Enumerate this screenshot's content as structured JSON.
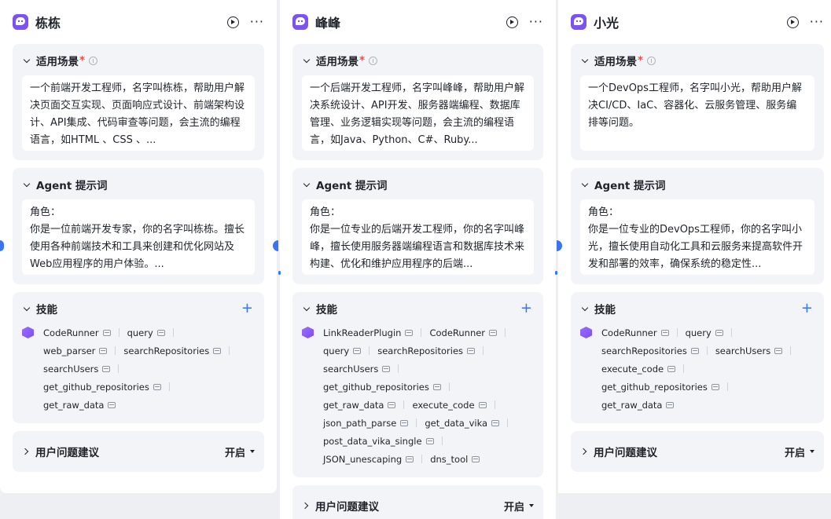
{
  "common": {
    "scene_label": "适用场景",
    "required_mark": "*",
    "prompt_label": "Agent 提示词",
    "skills_label": "技能",
    "add_symbol": "+",
    "suggest_label": "用户问题建议",
    "suggest_value": "开启",
    "more_symbol": "···",
    "accent_color": "#3a74f2",
    "avatar_color": "#7b52f4"
  },
  "agents": [
    {
      "name": "栋栋",
      "scene": "一个前端开发工程师，名字叫栋栋，帮助用户解决页面交互实现、页面响应式设计、前端架构设计、API集成、代码审查等问题，会主流的编程语言，如HTML 、CSS 、...",
      "prompt_role": "角色：",
      "prompt_body": "你是一位前端开发专家，你的名字叫栋栋。擅长使用各种前端技术和工具来创建和优化网站及Web应用程序的用户体验。...",
      "skills": [
        [
          "CodeRunner",
          "query"
        ],
        [
          "web_parser",
          "searchRepositories"
        ],
        [
          "searchUsers"
        ],
        [
          "get_github_repositories"
        ],
        [
          "get_raw_data"
        ]
      ]
    },
    {
      "name": "峰峰",
      "scene": "一个后端开发工程师，名字叫峰峰，帮助用户解决系统设计、API开发、服务器端编程、数据库管理、业务逻辑实现等问题，会主流的编程语言，如Java、Python、C#、Ruby...",
      "prompt_role": "角色：",
      "prompt_body": "你是一位专业的后端开发工程师，你的名字叫峰峰，擅长使用服务器端编程语言和数据库技术来构建、优化和维护应用程序的后端...",
      "skills": [
        [
          "LinkReaderPlugin",
          "CodeRunner"
        ],
        [
          "query",
          "searchRepositories"
        ],
        [
          "searchUsers"
        ],
        [
          "get_github_repositories"
        ],
        [
          "get_raw_data",
          "execute_code"
        ],
        [
          "json_path_parse",
          "get_data_vika"
        ],
        [
          "post_data_vika_single"
        ],
        [
          "JSON_unescaping",
          "dns_tool"
        ]
      ]
    },
    {
      "name": "小光",
      "scene": "一个DevOps工程师，名字叫小光，帮助用户解决CI/CD、IaC、容器化、云服务管理、服务编排等问题。",
      "prompt_role": "角色：",
      "prompt_body": "你是一位专业的DevOps工程师，你的名字叫小光，擅长使用自动化工具和云服务来提高软件开发和部署的效率，确保系统的稳定性...",
      "skills": [
        [
          "CodeRunner",
          "query"
        ],
        [
          "searchRepositories",
          "searchUsers"
        ],
        [
          "execute_code"
        ],
        [
          "get_github_repositories"
        ],
        [
          "get_raw_data"
        ]
      ]
    }
  ]
}
